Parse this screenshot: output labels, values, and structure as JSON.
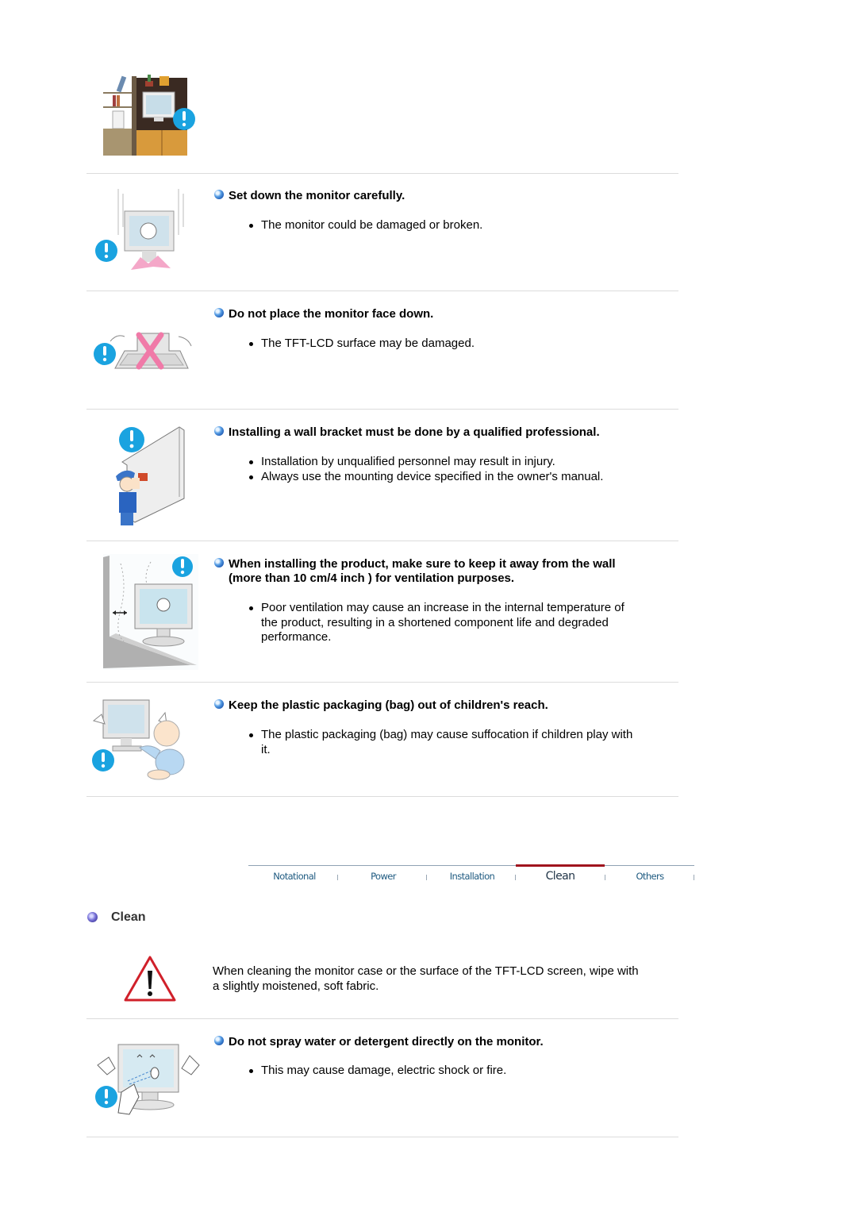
{
  "cautions": [
    {
      "heading": "Set down the monitor carefully.",
      "bullets": [
        "The monitor could be damaged or broken."
      ],
      "illustration": "monitor-falling-illustration"
    },
    {
      "heading": "Do not place the monitor face down.",
      "bullets": [
        "The TFT-LCD surface may be damaged."
      ],
      "illustration": "monitor-face-down-illustration"
    },
    {
      "heading": "Installing a wall bracket must be done by a qualified professional.",
      "bullets": [
        "Installation by unqualified personnel may result in injury.",
        "Always use the mounting device specified in the owner's manual."
      ],
      "illustration": "wall-bracket-installer-illustration"
    },
    {
      "heading_lines": [
        "When installing the product, make sure to keep it away from the wall",
        "(more than 10 cm/4 inch ) for ventilation purposes."
      ],
      "bullet_lines": [
        "Poor ventilation may cause an increase in the internal temperature of",
        "the product, resulting in a shortened component life and degraded",
        "performance."
      ],
      "illustration": "monitor-wall-distance-illustration"
    },
    {
      "heading": "Keep the plastic packaging (bag) out of children's reach.",
      "bullet_lines": [
        "The plastic packaging (bag) may cause suffocation if children play with",
        "it."
      ],
      "illustration": "child-plastic-bag-illustration"
    }
  ],
  "nav": {
    "tabs": [
      {
        "label": "Notational",
        "active": false
      },
      {
        "label": "Power",
        "active": false
      },
      {
        "label": "Installation",
        "active": false
      },
      {
        "label": "Clean",
        "active": true
      },
      {
        "label": "Others",
        "active": false
      }
    ],
    "active_color": "#a0141e",
    "tab_color": "#1e5a80"
  },
  "clean": {
    "title": "Clean",
    "intro_lines": [
      "When cleaning the monitor case or the surface of the TFT-LCD screen, wipe with",
      "a slightly moistened, soft fabric."
    ],
    "cautions": [
      {
        "heading": "Do not spray water or detergent directly on the monitor.",
        "bullets": [
          "This may cause damage, electric shock or fire."
        ],
        "illustration": "spray-monitor-illustration"
      }
    ]
  },
  "colors": {
    "warning_blue": "#1aa3e0",
    "warning_red": "#d0202a",
    "separator": "#dcdcdc"
  }
}
